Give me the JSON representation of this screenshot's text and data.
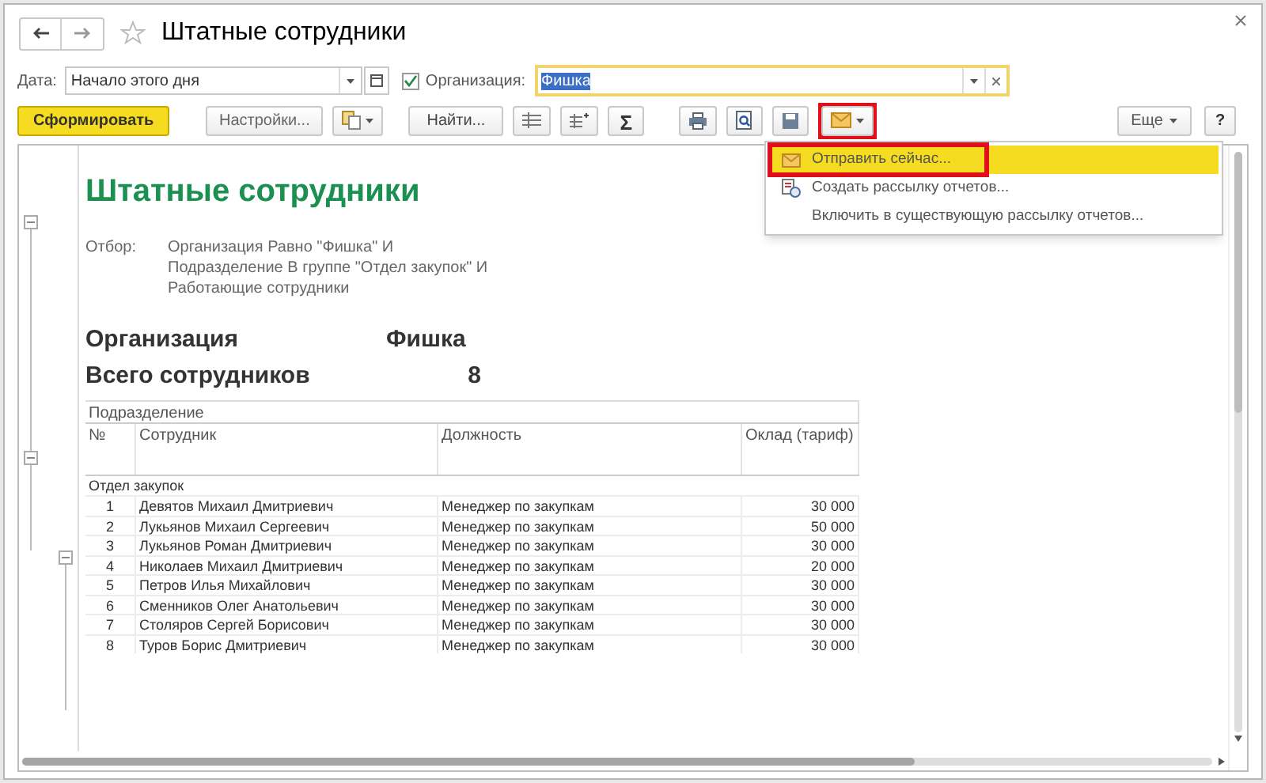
{
  "window": {
    "title": "Штатные сотрудники"
  },
  "filters": {
    "date_label": "Дата:",
    "date_value": "Начало этого дня",
    "org_checked": true,
    "org_label": "Организация:",
    "org_value": "Фишка"
  },
  "toolbar": {
    "generate": "Сформировать",
    "settings": "Настройки...",
    "find": "Найти...",
    "sum": "Σ",
    "more": "Еще",
    "help": "?"
  },
  "menu": [
    {
      "label": "Отправить сейчас...",
      "selected": true,
      "kind": "mail"
    },
    {
      "label": "Создать рассылку отчетов...",
      "selected": false,
      "kind": "create"
    },
    {
      "label": "Включить в существующую рассылку отчетов...",
      "selected": false,
      "kind": "plain"
    }
  ],
  "report": {
    "title": "Штатные сотрудники",
    "filter_label": "Отбор:",
    "filter_lines": [
      "Организация Равно \"Фишка\" И",
      "Подразделение В группе \"Отдел закупок\" И",
      "Работающие сотрудники"
    ],
    "summary": [
      {
        "label": "Организация",
        "value": "Фишка"
      },
      {
        "label": "Всего сотрудников",
        "value": "8"
      }
    ],
    "group_header": "Подразделение",
    "columns": [
      "№",
      "Сотрудник",
      "Должность",
      "Оклад (тариф)"
    ],
    "group": "Отдел закупок",
    "rows": [
      [
        "1",
        "Девятов Михаил Дмитриевич",
        "Менеджер по закупкам",
        "30 000"
      ],
      [
        "2",
        "Лукьянов Михаил Сергеевич",
        "Менеджер по закупкам",
        "50 000"
      ],
      [
        "3",
        "Лукьянов Роман Дмитриевич",
        "Менеджер по закупкам",
        "30 000"
      ],
      [
        "4",
        "Николаев Михаил Дмитриевич",
        "Менеджер по закупкам",
        "20 000"
      ],
      [
        "5",
        "Петров Илья Михайлович",
        "Менеджер по закупкам",
        "30 000"
      ],
      [
        "6",
        "Сменников Олег Анатольевич",
        "Менеджер по закупкам",
        "30 000"
      ],
      [
        "7",
        "Столяров Сергей Борисович",
        "Менеджер по закупкам",
        "30 000"
      ],
      [
        "8",
        "Туров Борис Дмитриевич",
        "Менеджер по закупкам",
        "30 000"
      ]
    ]
  }
}
